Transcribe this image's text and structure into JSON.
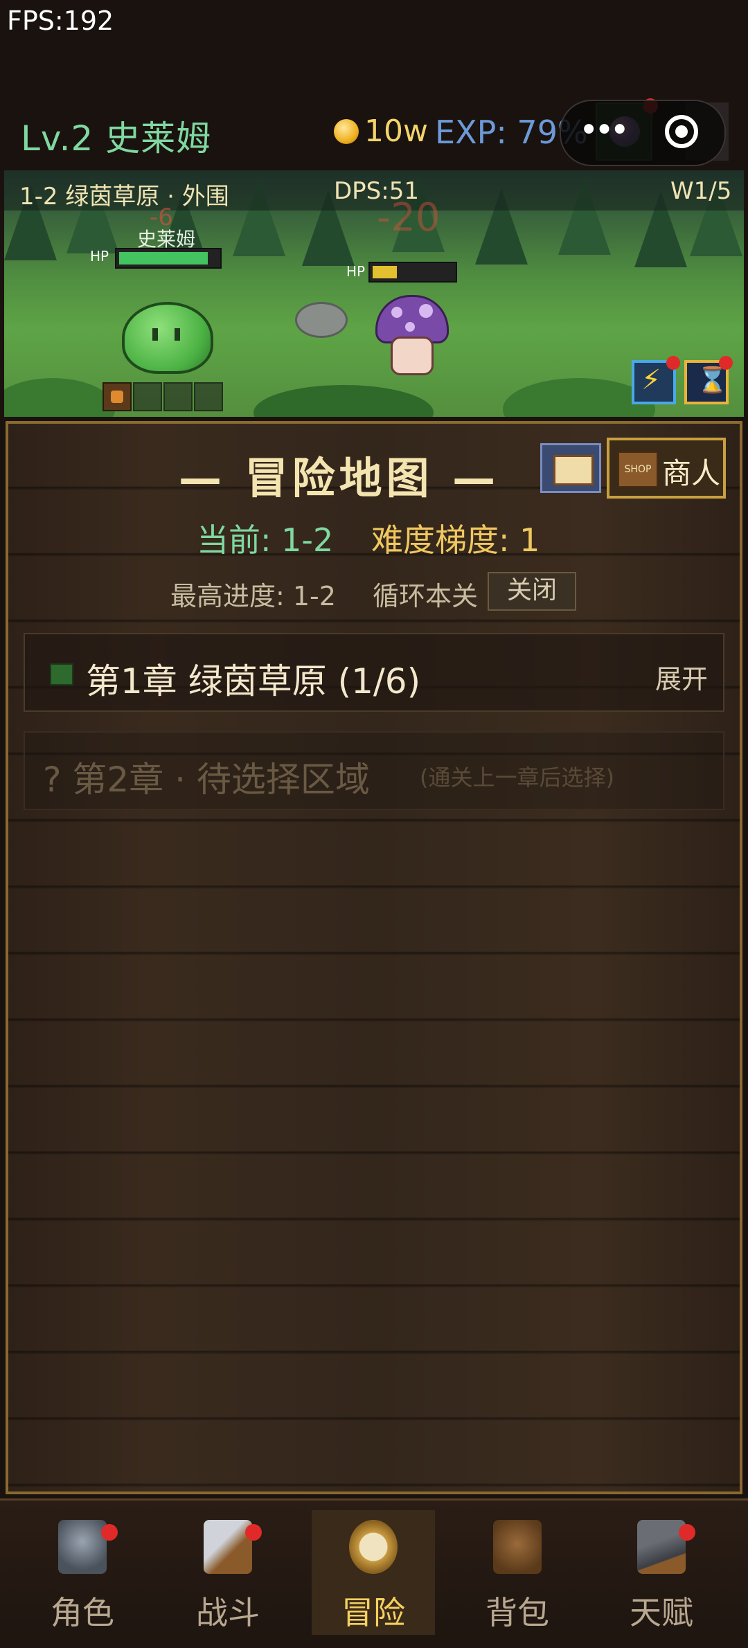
{
  "fps": "FPS:192",
  "header": {
    "level_name": "Lv.2 史莱姆",
    "gold": "10w",
    "exp": "EXP: 79%",
    "capsule_dots": "•••"
  },
  "scene": {
    "stage": "1-2 绿茵草原 · 外围",
    "dps": "DPS:51",
    "wave": "W1/5",
    "player_name": "史莱姆",
    "player_hp_label": "HP",
    "player_hp": 0.9,
    "enemy_hp_label": "HP",
    "enemy_hp": 0.3,
    "damage_player": "-6",
    "damage_enemy": "-20",
    "speed_icon": "⚡",
    "hourglass_icon": "⌛"
  },
  "panel": {
    "title": "— 冒险地图 —",
    "shop_sign": "SHOP",
    "shop_label": "商人",
    "current": "当前: 1-2",
    "difficulty": "难度梯度: 1",
    "best": "最高进度: 1-2",
    "loop_label": "循环本关",
    "loop_button": "关闭",
    "chapters": [
      {
        "title": "第1章 绿茵草原 (1/6)",
        "toggle": "展开"
      },
      {
        "title": "? 第2章 · 待选择区域",
        "hint": "(通关上一章后选择)"
      }
    ]
  },
  "nav": {
    "items": [
      {
        "label": "角色",
        "icon": "knight-icon",
        "badge": true
      },
      {
        "label": "战斗",
        "icon": "sword-shield-icon",
        "badge": true
      },
      {
        "label": "冒险",
        "icon": "compass-icon",
        "badge": false,
        "active": true
      },
      {
        "label": "背包",
        "icon": "backpack-icon",
        "badge": false
      },
      {
        "label": "天赋",
        "icon": "anvil-icon",
        "badge": true
      }
    ]
  },
  "colors": {
    "accent_green": "#7fd8a0",
    "gold": "#f0c860",
    "badge_red": "#e02a2a"
  }
}
